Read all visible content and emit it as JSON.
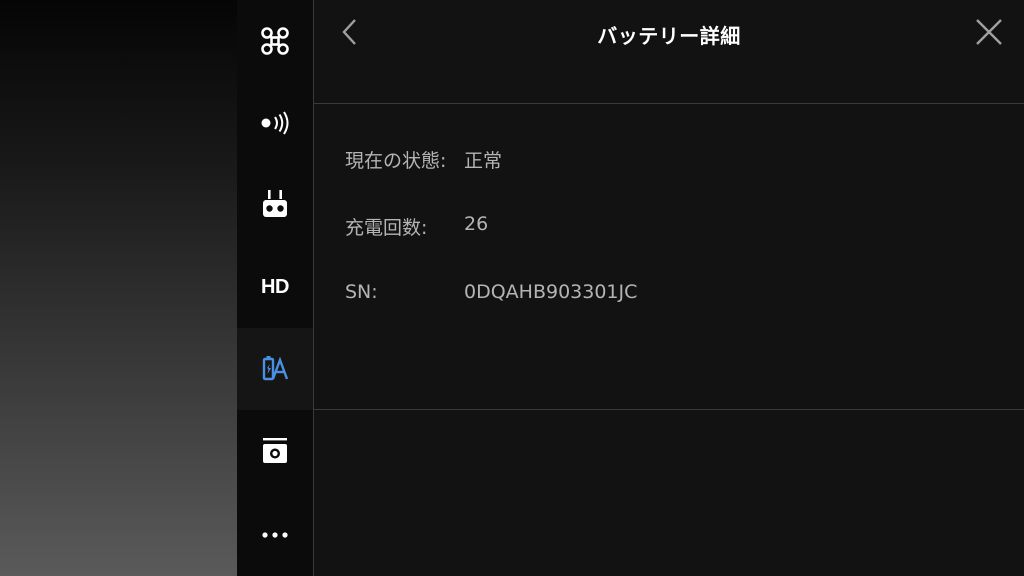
{
  "header": {
    "title": "バッテリー詳細"
  },
  "sidebar": {
    "items": [
      {
        "name": "aircraft",
        "icon": "drone-icon",
        "active": false
      },
      {
        "name": "signal",
        "icon": "signal-broadcast-icon",
        "active": false
      },
      {
        "name": "remote-controller",
        "icon": "remote-controller-icon",
        "active": false
      },
      {
        "name": "hd",
        "label": "HD",
        "active": false
      },
      {
        "name": "battery",
        "icon": "battery-icon",
        "active": true
      },
      {
        "name": "camera",
        "icon": "camera-icon",
        "active": false
      },
      {
        "name": "more",
        "icon": "more-dots-icon",
        "active": false
      }
    ]
  },
  "battery": {
    "status_label": "現在の状態:",
    "status_value": "正常",
    "cycles_label": "充電回数:",
    "cycles_value": "26",
    "sn_label": "SN:",
    "sn_value": "0DQAHB903301JC"
  },
  "colors": {
    "accent": "#4a90e2",
    "panel_bg": "#121212",
    "sidebar_bg": "#0b0b0b",
    "divider": "#3a3a3a",
    "text_secondary": "#b4b4b4"
  }
}
